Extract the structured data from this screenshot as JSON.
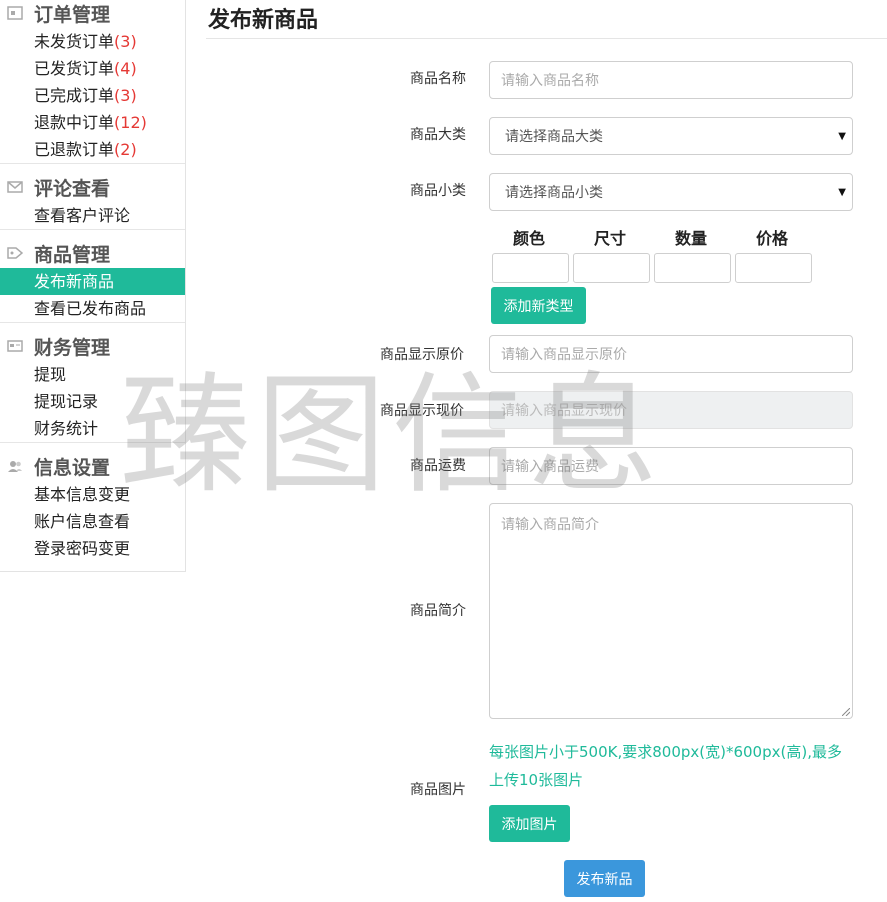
{
  "sidebar": {
    "sections": [
      {
        "title": "订单管理",
        "icon": "calendar-icon",
        "items": [
          {
            "label": "未发货订单",
            "count": "(3)"
          },
          {
            "label": "已发货订单",
            "count": "(4)"
          },
          {
            "label": "已完成订单",
            "count": "(3)"
          },
          {
            "label": "退款中订单",
            "count": "(12)"
          },
          {
            "label": "已退款订单",
            "count": "(2)"
          }
        ]
      },
      {
        "title": "评论查看",
        "icon": "envelope-icon",
        "items": [
          {
            "label": "查看客户评论"
          }
        ]
      },
      {
        "title": "商品管理",
        "icon": "tag-icon",
        "items": [
          {
            "label": "发布新商品",
            "active": true
          },
          {
            "label": "查看已发布商品"
          }
        ]
      },
      {
        "title": "财务管理",
        "icon": "card-icon",
        "items": [
          {
            "label": "提现"
          },
          {
            "label": "提现记录"
          },
          {
            "label": "财务统计"
          }
        ]
      },
      {
        "title": "信息设置",
        "icon": "users-icon",
        "items": [
          {
            "label": "基本信息变更"
          },
          {
            "label": "账户信息查看"
          },
          {
            "label": "登录密码变更"
          }
        ]
      }
    ]
  },
  "main": {
    "title": "发布新商品",
    "form": {
      "name_label": "商品名称",
      "name_placeholder": "请输入商品名称",
      "category_label": "商品大类",
      "category_value": "请选择商品大类",
      "subcategory_label": "商品小类",
      "subcategory_value": "请选择商品小类",
      "spec_headers": [
        "颜色",
        "尺寸",
        "数量",
        "价格"
      ],
      "add_type_button": "添加新类型",
      "orig_price_label": "商品显示原价",
      "orig_price_placeholder": "请输入商品显示原价",
      "cur_price_label": "商品显示现价",
      "cur_price_placeholder": "请输入商品显示现价",
      "shipping_label": "商品运费",
      "shipping_placeholder": "请输入商品运费",
      "desc_label": "商品简介",
      "desc_placeholder": "请输入商品简介",
      "image_label": "商品图片",
      "image_hint": "每张图片小于500K,要求800px(宽)*600px(高),最多上传10张图片",
      "add_image_button": "添加图片",
      "submit_button": "发布新品"
    }
  },
  "watermark": "臻图信息",
  "colors": {
    "accent": "#1fba9a",
    "submit": "#3b97dc",
    "count": "#e53935"
  }
}
